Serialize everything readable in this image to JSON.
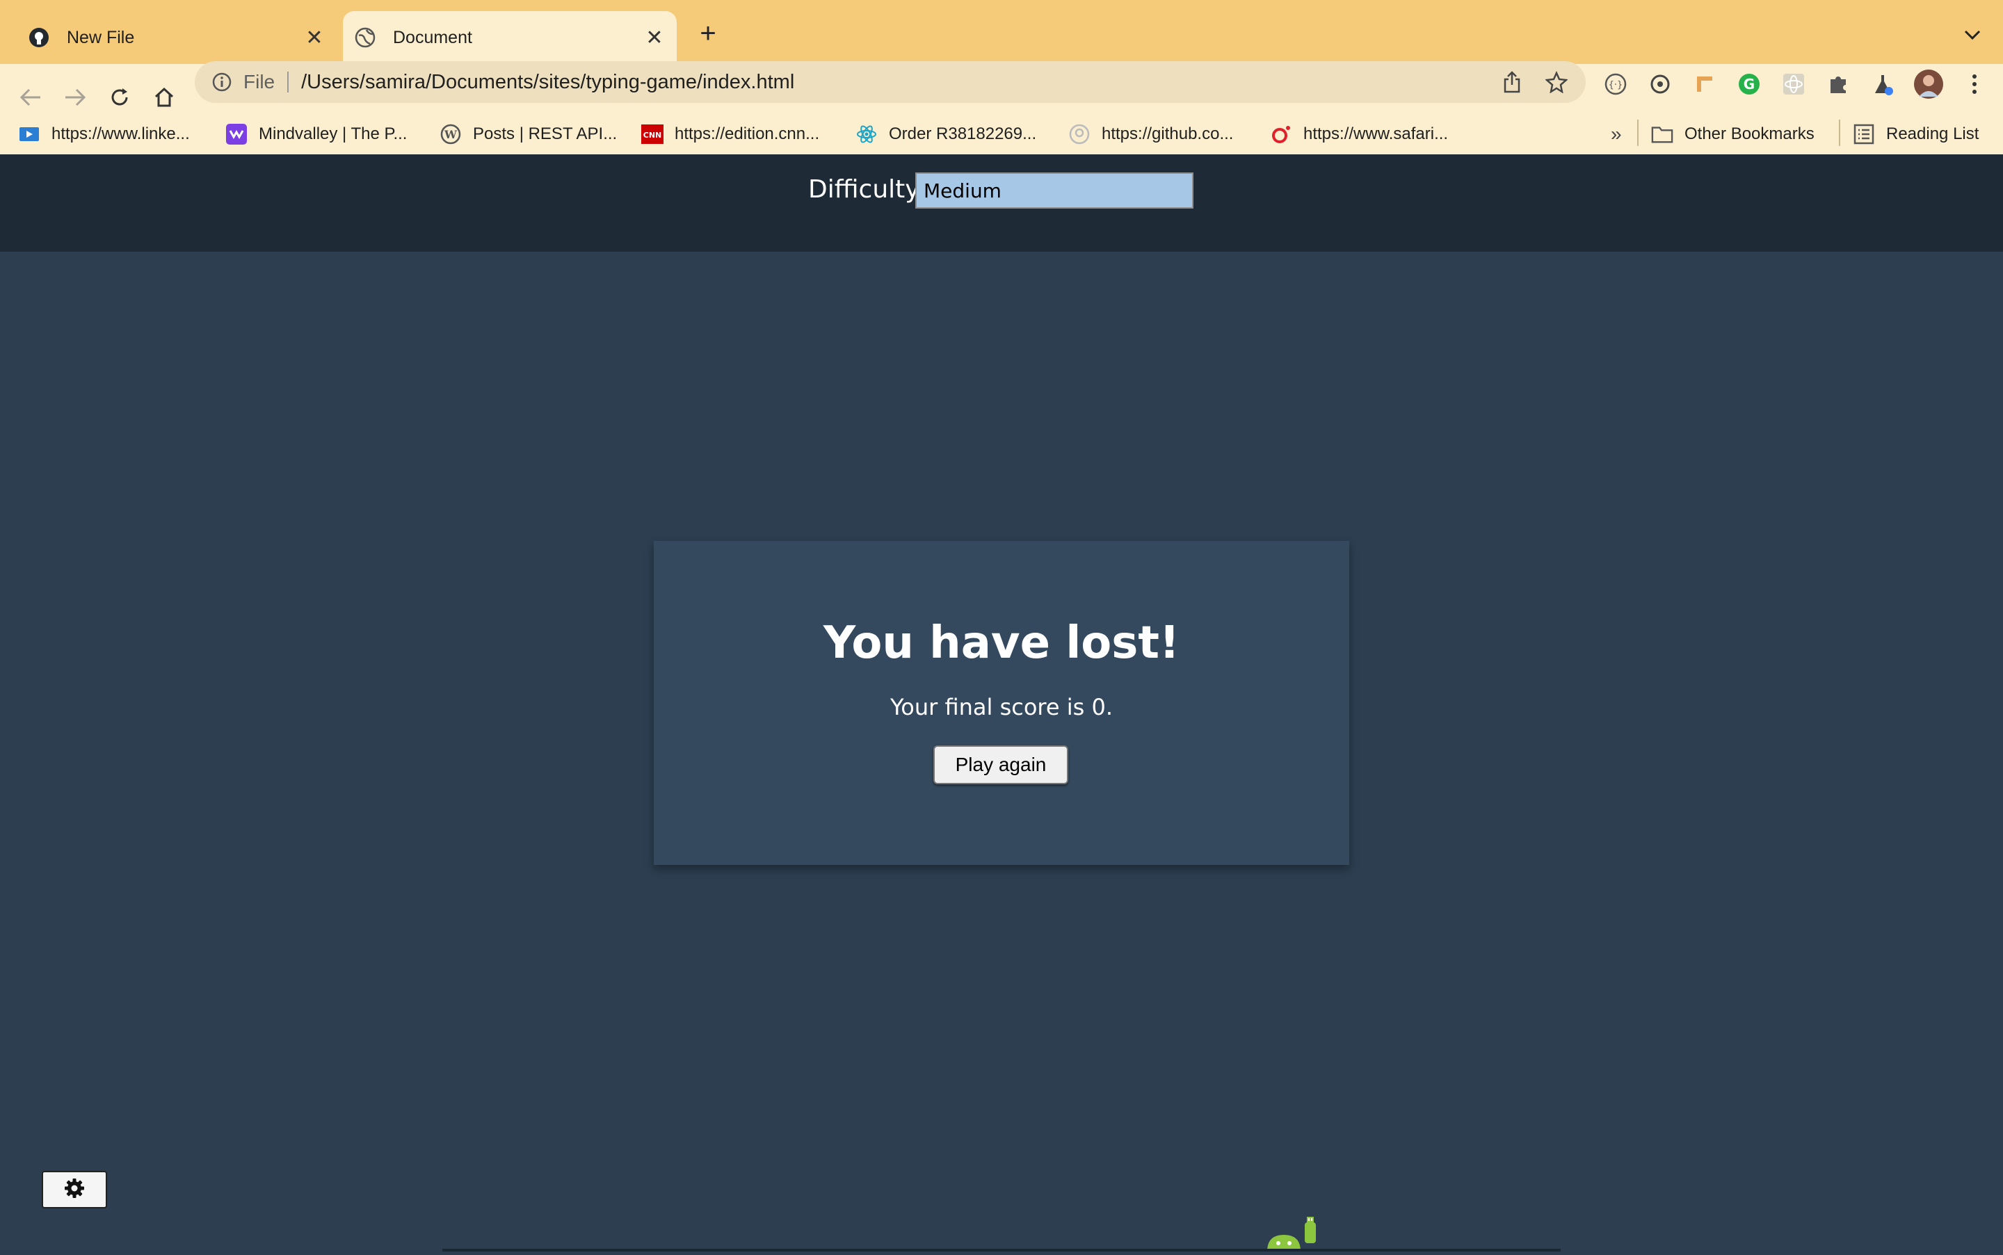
{
  "browser": {
    "tabs": [
      {
        "title": "New File",
        "favicon": "github-icon",
        "active": false
      },
      {
        "title": "Document",
        "favicon": "globe-icon",
        "active": true
      }
    ],
    "address": {
      "scheme": "File",
      "url": "/Users/samira/Documents/sites/typing-game/index.html"
    },
    "bookmarks": [
      {
        "label": "https://www.linke...",
        "icon": "video-icon"
      },
      {
        "label": "Mindvalley | The P...",
        "icon": "mindvalley-icon"
      },
      {
        "label": "Posts | REST API...",
        "icon": "wordpress-icon"
      },
      {
        "label": "https://edition.cnn...",
        "icon": "cnn-icon"
      },
      {
        "label": "Order R38182269...",
        "icon": "react-icon"
      },
      {
        "label": "https://github.co...",
        "icon": "github-icon"
      },
      {
        "label": "https://www.safari...",
        "icon": "safari-icon"
      }
    ],
    "overflow": "»",
    "other_bookmarks": "Other Bookmarks",
    "reading_list": "Reading List"
  },
  "page": {
    "difficulty_label": "Difficulty",
    "difficulty_value": "Medium",
    "end_title": "You have lost!",
    "end_message": "Your final score is 0.",
    "play_again": "Play again"
  },
  "colors": {
    "tabbar": "#f5ca78",
    "toolbar": "#fcefcf",
    "page_bg": "#2c3e50",
    "header_bg": "#1f2a37",
    "modal_bg": "#34495e",
    "select_bg": "#a7c7e7"
  }
}
